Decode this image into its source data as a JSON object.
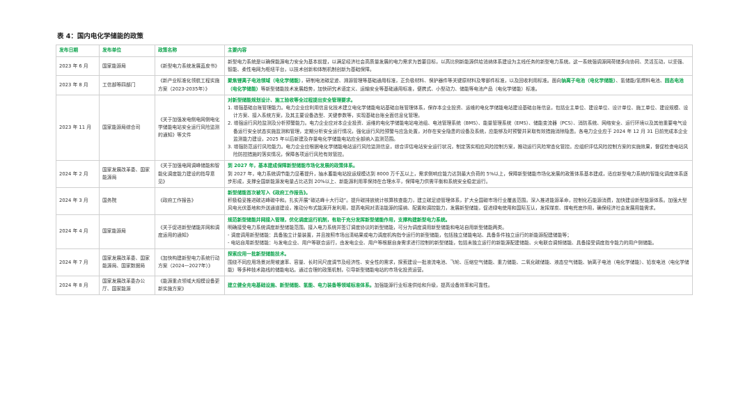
{
  "caption": "表 4：国内电化学储能的政策",
  "headers": [
    "发布日期",
    "发布单位",
    "政策名称",
    "主要内容"
  ],
  "rows": [
    {
      "date": "2023 年 6 月",
      "org": "国家能源局",
      "policy": "《新型电力系统发展蓝皮书》",
      "content": [
        [
          {
            "t": "新型电力系统是以确保能源电力安全为基本前提，以满足经济社会高质量发展的电力需求为首要目标，以高比例新能源供给消纳体系建设为主线任务的新型电力系统。这一系统强调源网荷储多向协同、灵活互动，以坚强、智能、柔性电网为枢纽平台，以技术创新和体制机制创新为基础保障。"
          }
        ]
      ]
    },
    {
      "date": "2023 年 8 月",
      "org": "工信部等四部门",
      "policy": "《新产业标准化领航工程实施方案（2023-2035年）》",
      "content": [
        [
          {
            "t": "聚焦锂离子电池领域（电化学储能）",
            "g": true
          },
          {
            "t": "，研制电池碳足迹、溯源管理等基础通用标准，正负极材料、保护器件等关键原材料及零部件标准，以及回收利用标准。面向"
          },
          {
            "t": "钠离子电池（电化学储能）",
            "g": true
          },
          {
            "t": "、氢储能/氢燃料电池、"
          },
          {
            "t": "固态电池（电化学储能）",
            "g": true
          },
          {
            "t": "等新型储能技术发展趋势，加快研究术语定义、运输安全等基础通用标准，便携式、小型动力、储能等电池产品（电化学储能）标准。"
          }
        ]
      ]
    },
    {
      "date": "2023 年 11 月",
      "org": "国家能源局综合司",
      "policy": "《关于加强发电侧电网侧电化学储能电站安全运行风险监测的通知》等文件",
      "content": [
        [
          {
            "t": "对新型储能规划设计、施工验收等全过程提出安全管理要求。",
            "g": true
          }
        ],
        [
          {
            "t": "1. 增强基础台账管理能力。电力企业应利用信息化技术建立电化学储能电站基础台账管理体系，保存本企业投资、运维的电化学储能电站建设基础台账信息，包括业主单位、建设单位、设计单位、施工单位、建设规模、设计方案、接入系统方案，及其主要设备选型、关键参数等，实现基础台账全面信息化管理。"
          }
        ],
        [
          {
            "t": "2. 增强运行风险监测及分析预警能力。电力企业应对本企业投资、运维的电化学储能电站电池组、电池管理系统（BMS）、能量管理系统（EMS）、储能变流器（PCS）、消防系统、网络安全、运行环境以及其他重要电气设备运行安全状态实施监测和管理，定期分析安全运行情况，强化运行风险预警与应急处置，对存在安全隐患的设备及系统，应能够及时预警并采取有效措施消除隐患。各电力企业应于 2024 年 12 月 31 日前完成本企业监测能力建设，2025 年以后新建及存量电化学储能电站应全部纳入监测范围。"
          }
        ],
        [
          {
            "t": "3. 增强防范运行风险能力。电力企业应根据电化学储能电站运行风险监测信息，综合评估电站安全运行状况，制定落实相应风险控制方案，推动运行风险常态化管控。应组织评估风险控制方案的实施效果，督促检查电站风险防控措施的落实情况，保障各项运行风险有效管控。"
          }
        ]
      ]
    },
    {
      "date": "2024 年 2 月",
      "org": "国家发展改革委、国家能源局",
      "policy": "《关于加强电网调峰储能和智能化调度能力建设的指导意见》",
      "content": [
        [
          {
            "t": "到 2027 年，基本建成保障新型储能市场化发展的政策体系。",
            "g": true
          }
        ],
        [
          {
            "t": "到 2027 年，电力系统调节能力显著提升，抽水蓄能电站投运规模达到 8000 万千瓦以上，需求侧响应能力达到最大负荷的 5%以上，保障新型储能市场化发展的政策体系基本建成，适应新型电力系统的智能化调度体系逐步形成，支撑全国新能源发电量占比达到 20%以上、新能源利用率保持在合理水平，保障电力供需平衡和系统安全稳定运行。"
          }
        ]
      ]
    },
    {
      "date": "2024 年 3 月",
      "org": "国务院",
      "policy": "《政府工作报告》",
      "content": [
        [
          {
            "t": "新型储能首次被写入《政府工作报告》。",
            "g": true
          }
        ],
        [
          {
            "t": "积极稳妥推进碳达峰碳中和。扎实开展“碳达峰十大行动”。提升碳排放统计核算核查能力，建立碳足迹管理体系，扩大全国碳市场行业覆盖范围。深入推进能源革命，控制化石能源消费，加快建设新型能源体系。加强大型风电光伏基地和外送通道建设，推动分布式能源开发利用，提高电网对清洁能源的接纳、配置和调控能力，发展新型储能，促进绿电使用和国际互认，发挥煤炭、煤电兜底作用，确保经济社会发展用能需求。"
          }
        ]
      ]
    },
    {
      "date": "2024 年 4 月",
      "org": "国家能源局",
      "policy": "《关于促进新型储能并网和调度运用的通知》",
      "content": [
        [
          {
            "t": "规范新型储能并网接入管理，优化调度运行机制，有助于充分发挥新型储能作用，支撑构建新型电力系统。",
            "g": true
          }
        ],
        [
          {
            "t": "明确接受电力系统调度新型储能范围。接入电力系统并签订调度协议的新型储能，可分为调度调用新型储能和电站自用新型储能两类。"
          }
        ],
        [
          {
            "t": "- 调度调用新型储能：具备独立计量装置，并且按照市场出清结果或电力调度机构指令运行的新型储能，包括独立储能电站、具备条件独立运行的新能源配建储能等；"
          }
        ],
        [
          {
            "t": "- 电站自用新型储能：与发电企业、用户等联合运行，由发电企业、用户等根据自身需求进行控制的新型储能，包括未独立运行的新能源配建储能、火电联合调频储能、具备接受调度指令能力的用户侧储能。"
          }
        ]
      ]
    },
    {
      "date": "2024 年 7 月",
      "org": "国家发展改革委、国家能源局、国家数据局",
      "policy": "《加快构建新型电力系统行动方案（2024—2027年）》",
      "content": [
        [
          {
            "t": "探索应用一批新型储能技术。",
            "g": true
          }
        ],
        [
          {
            "t": "围绕不同应用场景对爬坡速率、容量、长时间尺度调节及经济性、安全性的需求，探索建设一批液流电池、飞轮、压缩空气储能、重力储能、二氧化碳储能、液态空气储能、钠离子电池（电化学储能）、铅炭电池（电化学储能）等多种技术路线的储能电站。通过合理的政策机制，引导新型储能电站的市场化投资运营。"
          }
        ]
      ]
    },
    {
      "date": "2024 年 8 月",
      "org": "国家发展改革委办公厅、国家能源",
      "policy": "《能源重点领域大规模设备更新实施方案》",
      "content": [
        [
          {
            "t": "建立健全充电基础设施、新型储能、氢能、电力装备等领域标准体系。",
            "g": true
          },
          {
            "t": "加强能源行业标准供给和升级，提高设备效率和可靠性。"
          }
        ]
      ]
    }
  ]
}
